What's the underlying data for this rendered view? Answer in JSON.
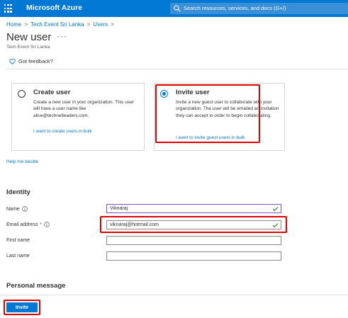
{
  "topbar": {
    "brand": "Microsoft Azure",
    "search_placeholder": "Search resources, services, and docs (G+/)"
  },
  "breadcrumb": {
    "items": [
      "Home",
      "Tech Event Sri Lanka",
      "Users"
    ]
  },
  "page": {
    "title": "New user",
    "subtitle": "Tech Event Sri Lanka",
    "feedback_label": "Got feedback?"
  },
  "options": {
    "create": {
      "title": "Create user",
      "desc": "Create a new user in your organization. This user will have a user name like alice@technetleaders.com.",
      "link": "I want to create users in bulk",
      "selected": false
    },
    "invite": {
      "title": "Invite user",
      "desc": "Invite a new guest user to collaborate with your organization. The user will be emailed an invitation they can accept in order to begin collaborating.",
      "link": "I want to invite guest users in bulk",
      "selected": true
    }
  },
  "help_link": "Help me decide",
  "identity": {
    "title": "Identity",
    "name_label": "Name",
    "name_value": "Viknaraj",
    "email_label": "Email address",
    "email_required": "*",
    "email_value": "viknaraj@hotmail.com",
    "first_name_label": "First name",
    "first_name_value": "",
    "last_name_label": "Last name",
    "last_name_value": ""
  },
  "personal_message": {
    "title": "Personal message"
  },
  "actions": {
    "invite_label": "Invite"
  },
  "colors": {
    "azure_blue": "#0078d4",
    "highlight_red": "#e00000",
    "valid_green": "#107c10"
  }
}
